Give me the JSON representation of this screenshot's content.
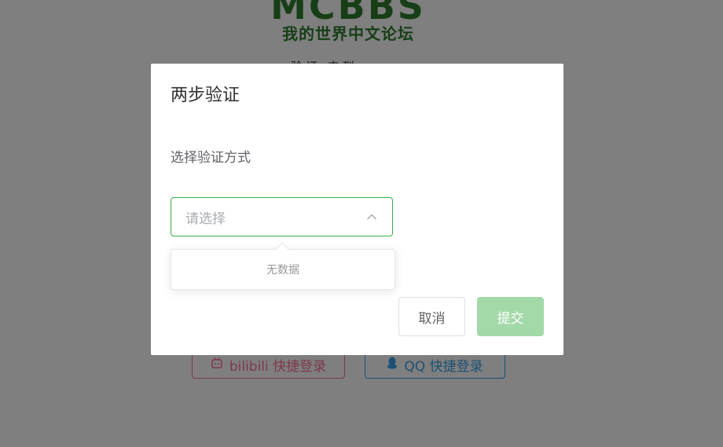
{
  "background": {
    "logo": {
      "mark": "MCBBS",
      "subtitle": "我的世界中文论坛"
    },
    "partial_text": "验证 来到",
    "login_buttons": [
      {
        "label": "bilibili 快捷登录",
        "icon": "bilibili-tv-icon",
        "color": "#fb7299"
      },
      {
        "label": "QQ 快捷登录",
        "icon": "qq-penguin-icon",
        "color": "#3aa0e8"
      }
    ]
  },
  "dialog": {
    "title": "两步验证",
    "field_label": "选择验证方式",
    "select": {
      "placeholder": "请选择",
      "icon": "chevron-up-icon"
    },
    "dropdown": {
      "empty_text": "无数据"
    },
    "buttons": {
      "cancel": "取消",
      "submit": "提交"
    }
  },
  "colors": {
    "accent": "#3dae47",
    "submit_disabled": "#a3d9a8",
    "logo_green": "#2f7d2f"
  }
}
